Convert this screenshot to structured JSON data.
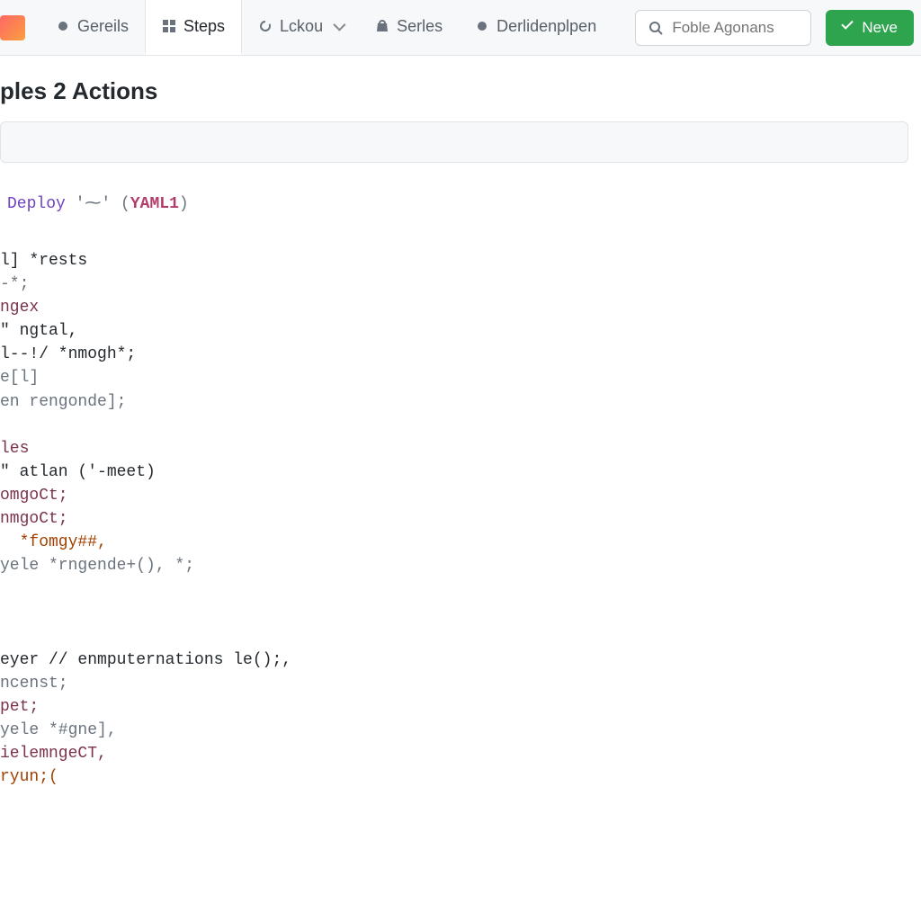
{
  "nav": {
    "items": [
      {
        "label": "Gereils",
        "icon": "dot"
      },
      {
        "label": "Steps",
        "icon": "grid",
        "active": true
      },
      {
        "label": "Lckou",
        "icon": "loop",
        "dropdown": true
      },
      {
        "label": "Serles",
        "icon": "bag"
      },
      {
        "label": "Derlidenplpen",
        "icon": "dot"
      }
    ]
  },
  "search": {
    "placeholder": "Foble Agonans"
  },
  "new_button": {
    "label": "Neve"
  },
  "page_title": "ples 2 Actions",
  "deploy": {
    "prefix": "Deploy",
    "mid": "'⁓'",
    "tag": "YAML1"
  },
  "code_lines": [
    {
      "cls": "d",
      "text": "l] *rests"
    },
    {
      "cls": "s",
      "text": "-*;"
    },
    {
      "cls": "m",
      "text": "ngex"
    },
    {
      "cls": "d",
      "text": "\" ngtal,"
    },
    {
      "cls": "d",
      "text": "l--!/ *nmogh*;"
    },
    {
      "cls": "s",
      "text": "e[l]"
    },
    {
      "cls": "s",
      "text": "en rengonde];"
    },
    {
      "cls": "d",
      "text": ""
    },
    {
      "cls": "m",
      "text": "les"
    },
    {
      "cls": "d",
      "text": "\" atlan ('-meet)"
    },
    {
      "cls": "m",
      "text": "omgoCt;"
    },
    {
      "cls": "m",
      "text": "nmgoCt;"
    },
    {
      "cls": "o",
      "text": "  *fomgy##,"
    },
    {
      "cls": "s",
      "text": "yele *rngende+(), *;"
    },
    {
      "cls": "d",
      "text": ""
    },
    {
      "cls": "d",
      "text": ""
    },
    {
      "cls": "d",
      "text": ""
    },
    {
      "cls": "d",
      "text": "eyer // enmputernations le();,"
    },
    {
      "cls": "s",
      "text": "ncenst;"
    },
    {
      "cls": "m",
      "text": "pet;"
    },
    {
      "cls": "s",
      "text": "yele *#gne],"
    },
    {
      "cls": "m",
      "text": "ielemngeCT,"
    },
    {
      "cls": "o",
      "text": "ryun;("
    }
  ]
}
